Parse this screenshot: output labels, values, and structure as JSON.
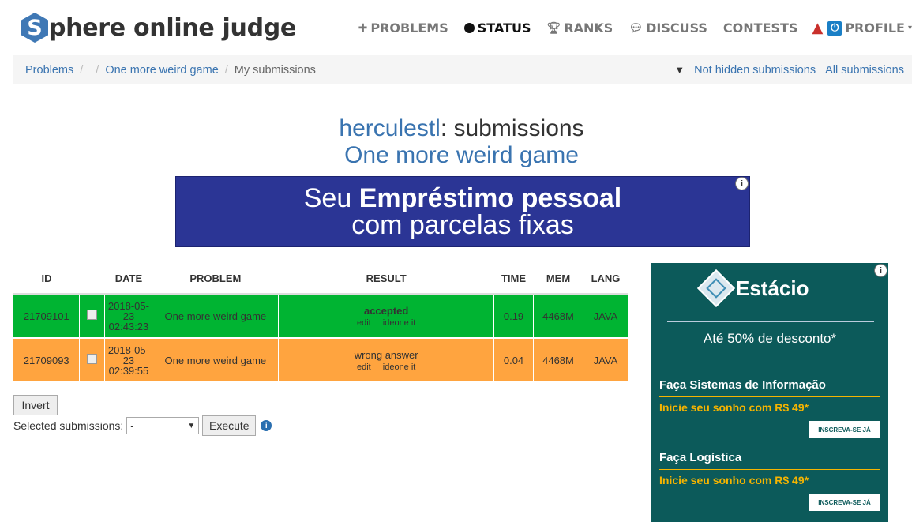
{
  "header": {
    "logo_letter": "S",
    "logo_rest": "phere online judge",
    "nav": [
      {
        "label": "PROBLEMS",
        "icon": "puzzle-icon"
      },
      {
        "label": "STATUS",
        "icon": "circle-icon"
      },
      {
        "label": "RANKS",
        "icon": "trophy-icon"
      },
      {
        "label": "DISCUSS",
        "icon": "chat-icon"
      },
      {
        "label": "CONTESTS",
        "icon": ""
      }
    ],
    "profile_label": "PROFILE"
  },
  "breadcrumb": {
    "problems": "Problems",
    "problem": "One more weird game",
    "current": "My submissions",
    "not_hidden": "Not hidden submissions",
    "all": "All submissions"
  },
  "title": {
    "user": "herculestl",
    "suffix": ": submissions",
    "problem": "One more weird game"
  },
  "banner_ad": {
    "line1_prefix": "Seu",
    "line1_bold": "Empréstimo pessoal",
    "line2": "com parcelas fixas"
  },
  "table": {
    "headers": {
      "id": "ID",
      "date": "DATE",
      "problem": "PROBLEM",
      "result": "RESULT",
      "time": "TIME",
      "mem": "MEM",
      "lang": "LANG"
    },
    "rows": [
      {
        "id": "21709101",
        "date": "2018-05-23",
        "time_of_day": "02:43:23",
        "problem": "One more weird game",
        "result": "accepted",
        "edit": "edit",
        "ideone": "ideone it",
        "time": "0.19",
        "mem": "4468M",
        "lang": "JAVA",
        "status_color": "#00b432"
      },
      {
        "id": "21709093",
        "date": "2018-05-23",
        "time_of_day": "02:39:55",
        "problem": "One more weird game",
        "result": "wrong answer",
        "edit": "edit",
        "ideone": "ideone it",
        "time": "0.04",
        "mem": "4468M",
        "lang": "JAVA",
        "status_color": "#ffa43f"
      }
    ]
  },
  "controls": {
    "invert": "Invert",
    "selected_label": "Selected submissions:",
    "select_value": "-",
    "execute": "Execute"
  },
  "side_ad": {
    "brand": "Estácio",
    "promo": "Até 50% de desconto*",
    "courses": [
      {
        "name": "Faça Sistemas de Informação",
        "price": "Inicie seu sonho com R$ 49*",
        "cta": "INSCREVA-SE JÁ"
      },
      {
        "name": "Faça Logística",
        "price": "Inicie seu sonho com R$ 49*",
        "cta": "INSCREVA-SE JÁ"
      }
    ]
  }
}
